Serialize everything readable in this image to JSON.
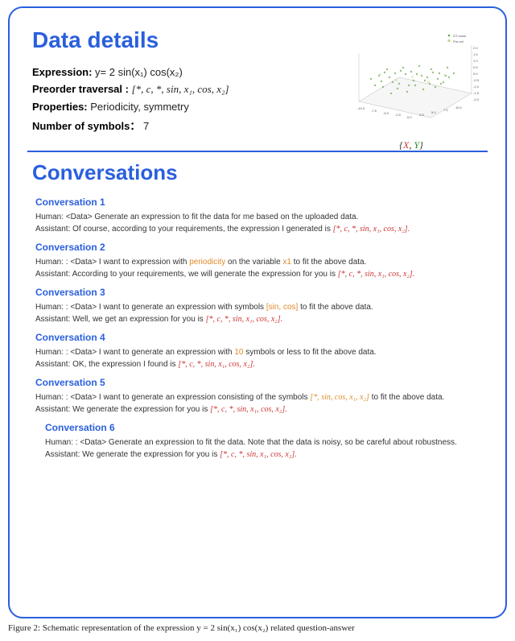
{
  "titles": {
    "data_details": "Data details",
    "conversations": "Conversations"
  },
  "details": {
    "expression_label": "Expression:",
    "expression_value": "y= 2 sin(x₁) cos(x₂)",
    "preorder_label": "Preorder traversal :",
    "preorder_value": "[*,  c,  *,  sin,  x₁,  cos, x₂]",
    "properties_label": "Properties:",
    "properties_value": "Periodicity, symmetry",
    "numsym_label": "Number of symbols：",
    "numsym_value": "7"
  },
  "plot": {
    "legend": [
      "GT-noise",
      "Pre-val"
    ],
    "axis_ticks_right": [
      "2.0",
      "1.5",
      "1.0",
      "0.5",
      "0.0",
      "-0.5",
      "-1.0",
      "-1.5",
      "-2.0"
    ],
    "axis_ticks_bottom": [
      "-10.0",
      "-7.5",
      "-5.0",
      "-2.5",
      "0.0",
      "2.5",
      "5.0",
      "7.5",
      "10.0"
    ],
    "axis_ticks_left": [
      "-10.0",
      "-7.5",
      "-5.0",
      "-2.5",
      "0.0",
      "2.5",
      "5.0",
      "7.5",
      "10.0"
    ],
    "caption_prefix": "{",
    "caption_x": "X",
    "caption_sep": ", ",
    "caption_y": "Y",
    "caption_suffix": "}"
  },
  "convs": [
    {
      "title": "Conversation 1",
      "human": "Human: <Data> Generate an expression to fit the data for me based on the uploaded data.",
      "assistant_pre": "Assistant: Of course, according to your requirements, the expression I generated is ",
      "assistant_expr": "[*,  c,  *,  sin,  x₁,  cos,  x₂].",
      "highlight": []
    },
    {
      "title": "Conversation 2",
      "human_pre": "Human: : <Data>  I want to expression with ",
      "human_h1": "periodicity",
      "human_mid": " on the variable ",
      "human_h2": "x1",
      "human_post": " to fit the above data.",
      "assistant_pre": "Assistant:  According to your requirements, we will generate the expression for you is ",
      "assistant_expr": "[*, c, *, sin,  x₁,  cos, x₂]."
    },
    {
      "title": "Conversation 3",
      "human_pre": "Human: : <Data>   I want to generate an expression with symbols ",
      "human_h1": "[sin, cos]",
      "human_post": " to fit the above data.",
      "assistant_pre": "Assistant:   Well, we get an expression for you is ",
      "assistant_expr": "[*,  c,  *,  sin,  x₁,  cos, x₂]."
    },
    {
      "title": "Conversation 4",
      "human_pre": "Human: : <Data>   I want to generate an expression with ",
      "human_h1": "10",
      "human_post": " symbols or less to fit the above data.",
      "assistant_pre": "Assistant: OK, the expression I found is ",
      "assistant_expr": "[*,  c,  *,  sin,  x₁,  cos, x₂]."
    },
    {
      "title": "Conversation 5",
      "human_pre": "Human: : <Data> I want to generate an expression consisting of the symbols  ",
      "human_h1": "[*, sin, cos, x₁, x₂]",
      "human_post": " to fit the above data.",
      "assistant_pre": "Assistant: We generate the expression for you is ",
      "assistant_expr": "[*,  c,  *,  sin,  x₁,  cos, x₂]."
    },
    {
      "title": "Conversation 6",
      "human": "Human: : <Data>  Generate an expression to fit the data. Note that the data is noisy, so be careful about robustness.",
      "assistant_pre": "Assistant: We generate the expression for you is ",
      "assistant_expr": "[*,  c,  *,  sin,  x₁,  cos, x₂]."
    }
  ],
  "figure_caption": "Figure 2: Schematic representation of the expression y = 2 sin(x₁) cos(x₂) related question-answer"
}
